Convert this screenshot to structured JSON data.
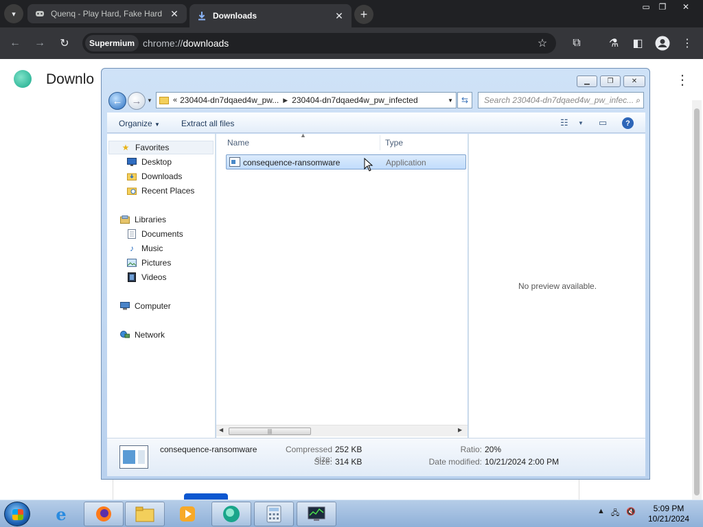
{
  "browser": {
    "tabs": [
      {
        "title": "Quenq - Play Hard, Fake Hard",
        "icon": "game-icon",
        "active": false
      },
      {
        "title": "Downloads",
        "icon": "download-icon",
        "active": true
      }
    ],
    "site_chip": "Supermium",
    "url_scheme": "chrome://",
    "url_host": "downloads"
  },
  "page": {
    "title": "Downlo"
  },
  "explorer": {
    "breadcrumb": [
      "230404-dn7dqaed4w_pw...",
      "230404-dn7dqaed4w_pw_infected"
    ],
    "search_placeholder": "Search 230404-dn7dqaed4w_pw_infec...",
    "commands": {
      "organize": "Organize",
      "extract": "Extract all files"
    },
    "nav": {
      "favorites": "Favorites",
      "desktop": "Desktop",
      "downloads": "Downloads",
      "recent": "Recent Places",
      "libraries": "Libraries",
      "documents": "Documents",
      "music": "Music",
      "pictures": "Pictures",
      "videos": "Videos",
      "computer": "Computer",
      "network": "Network"
    },
    "columns": {
      "name": "Name",
      "type": "Type"
    },
    "files": [
      {
        "name": "consequence-ransomware",
        "type": "Application"
      }
    ],
    "preview_text": "No preview available.",
    "details": {
      "name": "consequence-ransomware",
      "compressed_label": "Compressed size:",
      "compressed_value": "252 KB",
      "size_label": "Size:",
      "size_value": "314 KB",
      "ratio_label": "Ratio:",
      "ratio_value": "20%",
      "modified_label": "Date modified:",
      "modified_value": "10/21/2024 2:00 PM"
    }
  },
  "taskbar": {
    "time": "5:09 PM",
    "date": "10/21/2024"
  }
}
